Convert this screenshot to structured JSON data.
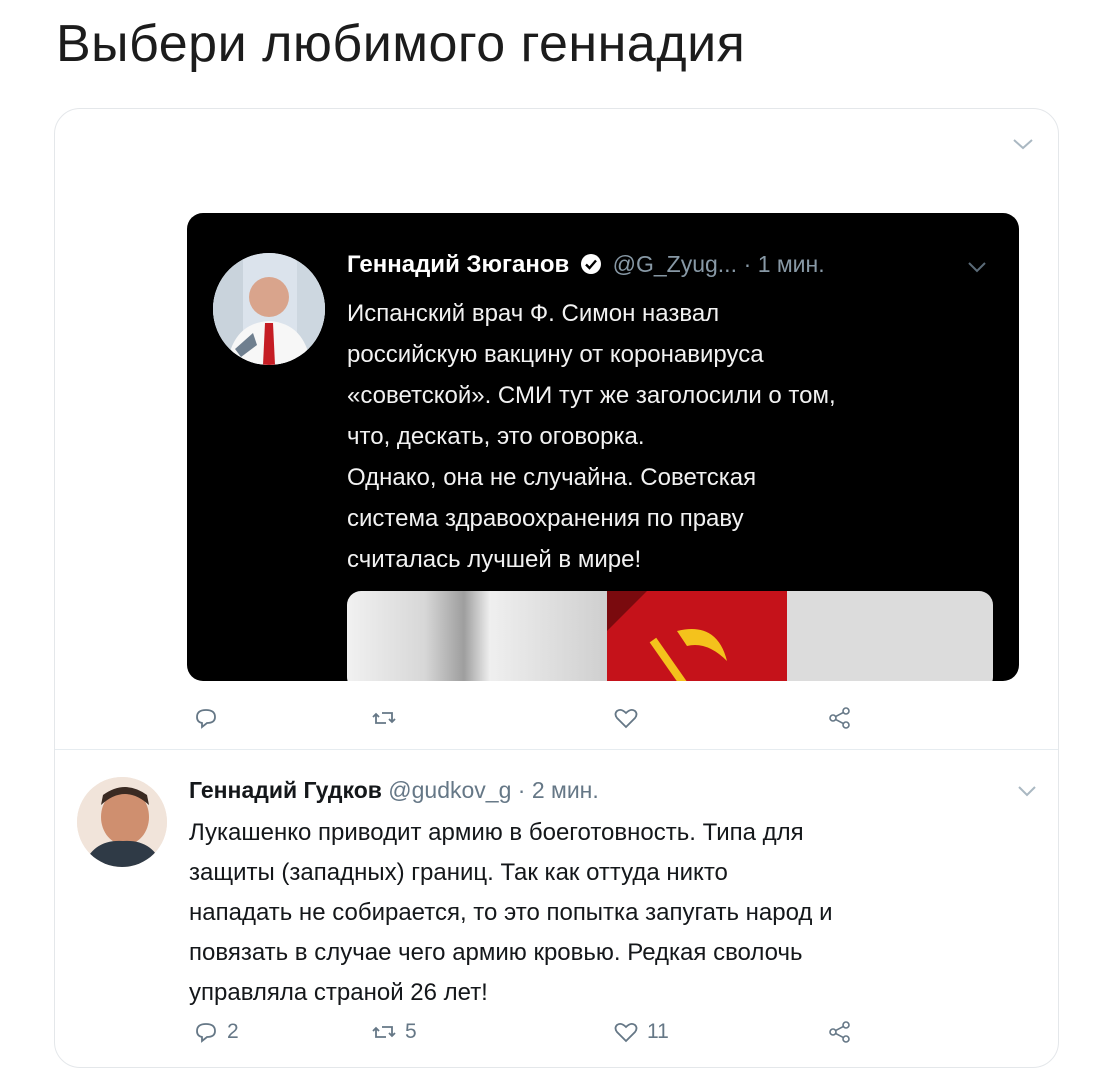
{
  "page": {
    "heading": "Выбери любимого геннадия"
  },
  "embedded_tweet": {
    "author_name": "Геннадий Зюганов",
    "handle": "@G_Zyug...",
    "time": "· 1 мин.",
    "text_lines": [
      "Испанский врач Ф. Симон назвал",
      "российскую вакцину от коронавируса",
      "«советской». СМИ тут же заголосили о том,",
      "что, дескать, это оговорка.",
      "Однако, она не случайна. Советская",
      "система здравоохранения по праву",
      "считалась лучшей в мире!"
    ]
  },
  "tweet_actions": {
    "reply": "",
    "retweet": "",
    "like": ""
  },
  "reply_tweet": {
    "author_name": "Геннадий Гудков",
    "handle": "@gudkov_g",
    "time": "· 2 мин.",
    "text_lines": [
      "Лукашенко приводит армию в боеготовность. Типа для",
      "защиты (западных) границ. Так как оттуда никто",
      "нападать не собирается, то это попытка запугать народ и",
      "повязать в случае чего армию кровью. Редкая сволочь",
      "управляла страной 26 лет!"
    ],
    "actions": {
      "reply": "2",
      "retweet": "5",
      "like": "11"
    }
  },
  "colors": {
    "dark_bg": "#000000",
    "muted": "#657786",
    "verified": "#ffffff",
    "flag_red": "#c5121a"
  }
}
